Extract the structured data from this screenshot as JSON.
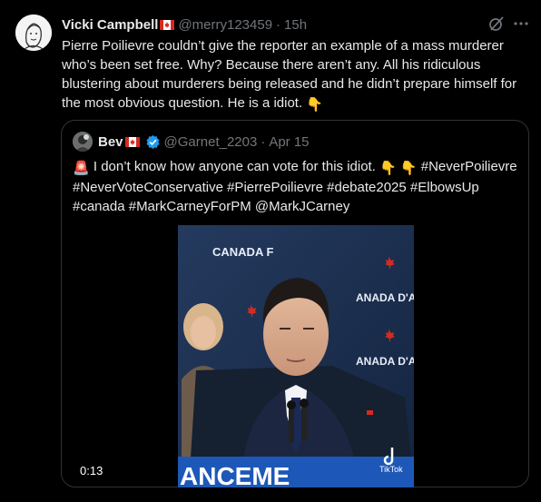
{
  "tweet": {
    "author_name": "Vicki Campbell",
    "author_handle": "@merry123459",
    "separator": "·",
    "time": "15h",
    "text": "Pierre Poilievre couldn’t give the reporter an example of a mass murderer who’s been set free. Why? Because there aren’t any. All his ridiculous blustering about murderers being released and he didn’t prepare himself for the most obvious question. He is a idiot.",
    "text_emoji": "👇"
  },
  "quote": {
    "author_name": "Bev",
    "author_handle": "@Garnet_2203",
    "separator": "·",
    "date": "Apr 15",
    "lead_emoji": "🚨",
    "text": "I don’t know how anyone can vote for this idiot.",
    "emojis": "👇 👇",
    "hashtags_1": "#NeverPoilievre",
    "line2": "#NeverVoteConservative #PierrePoilievre #debate2025 #ElbowsUp",
    "line3": "#canada #MarkCarneyForPM @MarkJCarney"
  },
  "video": {
    "duration": "0:13",
    "backdrop_text_1": "CANADA F",
    "backdrop_text_2": "ANADA D'A",
    "backdrop_text_3": "ANADA D'A",
    "podium_text": "ANCEME",
    "watermark": "TikTok"
  },
  "colors": {
    "background": "#000000",
    "text": "#e7e9ea",
    "muted": "#71767b",
    "border": "#2f3336",
    "verified": "#1d9bf0",
    "flag_red": "#d52b1e"
  },
  "icons": [
    "grok-icon",
    "more-icon",
    "verified-badge-icon",
    "canada-flag-icon",
    "tiktok-icon"
  ]
}
